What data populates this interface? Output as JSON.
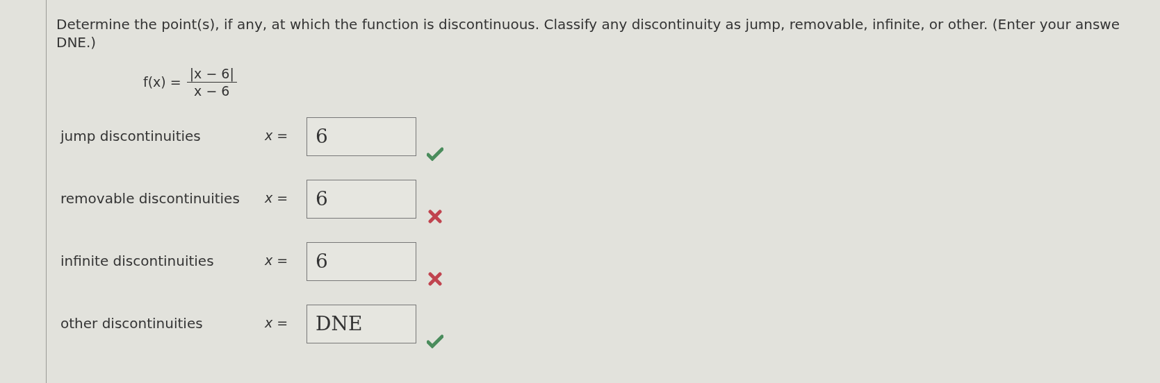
{
  "question": {
    "text": "Determine the point(s), if any, at which the function is discontinuous. Classify any discontinuity as jump, removable, infinite, or other. (Enter your answe",
    "text_line_2": "DNE.)"
  },
  "function": {
    "lhs": "f(x) =",
    "numerator": "|x − 6|",
    "denominator": "x − 6"
  },
  "answers": [
    {
      "label": "jump discontinuities",
      "prefix": "x =",
      "value": "6",
      "correct": true
    },
    {
      "label": "removable discontinuities",
      "prefix": "x =",
      "value": "6",
      "correct": false
    },
    {
      "label": "infinite discontinuities",
      "prefix": "x =",
      "value": "6",
      "correct": false
    },
    {
      "label": "other discontinuities",
      "prefix": "x =",
      "value": "DNE",
      "correct": true
    }
  ]
}
